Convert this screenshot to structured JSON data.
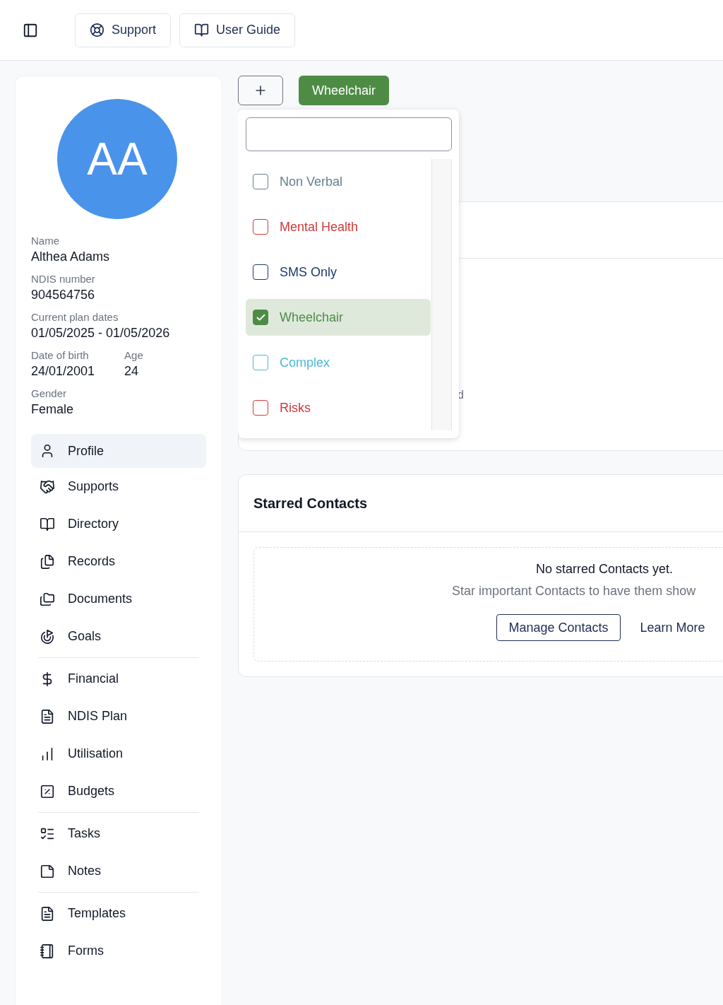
{
  "top_bar": {
    "buttons": [
      {
        "label": "Support"
      },
      {
        "label": "User Guide"
      }
    ]
  },
  "profile": {
    "initials": "AA",
    "fields": [
      {
        "label": "Name",
        "value": "Althea Adams"
      },
      {
        "label": "NDIS number",
        "value": "904564756"
      },
      {
        "label": "Current plan dates",
        "value": "01/05/2025 - 01/05/2026"
      },
      {
        "label": "Date of birth",
        "value": "24/01/2001",
        "label_2": "Age",
        "value_2": "24"
      },
      {
        "label": "Gender",
        "value": "Female"
      }
    ],
    "nav_groups": [
      [
        {
          "label": "Profile",
          "selected": true
        },
        {
          "label": "Supports",
          "selected": false
        },
        {
          "label": "Directory",
          "selected": false
        },
        {
          "label": "Records",
          "selected": false
        },
        {
          "label": "Documents",
          "selected": false
        },
        {
          "label": "Goals",
          "selected": false
        }
      ],
      [
        {
          "label": "Financial",
          "selected": false
        },
        {
          "label": "NDIS Plan",
          "selected": false
        },
        {
          "label": "Utilisation",
          "selected": false
        },
        {
          "label": "Budgets",
          "selected": false
        }
      ],
      [
        {
          "label": "Tasks",
          "selected": false
        },
        {
          "label": "Notes",
          "selected": false
        }
      ],
      [
        {
          "label": "Templates",
          "selected": false
        },
        {
          "label": "Forms",
          "selected": false
        }
      ]
    ]
  },
  "applied_tags": [
    {
      "label": "Wheelchair",
      "color": "#4e8c45"
    }
  ],
  "tag_dropdown": {
    "options": [
      {
        "label": "Non Verbal",
        "color": "#64808f",
        "checked": false
      },
      {
        "label": "Mental Health",
        "color": "#d03a3a",
        "checked": false
      },
      {
        "label": "SMS Only",
        "color": "#1e3a6e",
        "checked": false
      },
      {
        "label": "Wheelchair",
        "color": "#4e8c45",
        "checked": true
      },
      {
        "label": "Complex",
        "color": "#4ab8d4",
        "checked": false
      },
      {
        "label": "Risks",
        "color": "#d03a3a",
        "checked": false
      }
    ]
  },
  "hidden_card": {
    "fragment": "d"
  },
  "starred_contacts": {
    "title": "Starred Contacts",
    "empty_title": "No starred Contacts yet.",
    "empty_text": "Star important Contacts to have them show",
    "primary_button": "Manage Contacts",
    "link": "Learn More"
  }
}
